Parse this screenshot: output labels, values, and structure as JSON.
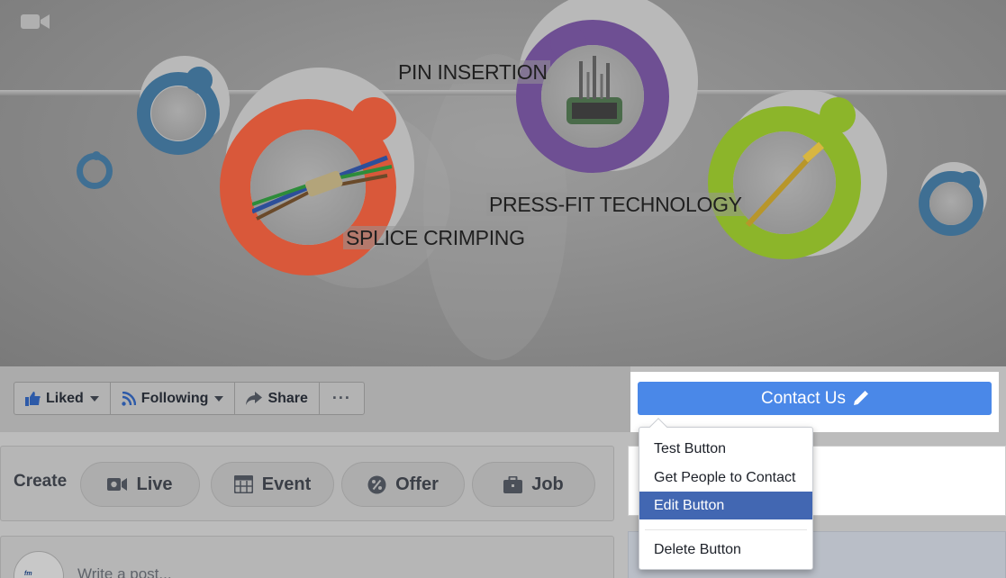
{
  "cover": {
    "labels": {
      "pin_insertion": "PIN INSERTION",
      "press_fit": "PRESS-FIT TECHNOLOGY",
      "splice_crimping": "SPLICE CRIMPING"
    },
    "ring_colors": {
      "blue": "#3f6f93",
      "orange": "#d9583a",
      "purple": "#6e4f93",
      "green": "#8cb52a"
    }
  },
  "page_actions": {
    "liked_label": "Liked",
    "following_label": "Following",
    "share_label": "Share",
    "more_label": "···"
  },
  "cta": {
    "label": "Contact Us",
    "color": "#4a88e8"
  },
  "create": {
    "label": "Create",
    "buttons": [
      {
        "label": "Live",
        "icon": "video-camera-icon"
      },
      {
        "label": "Event",
        "icon": "calendar-icon"
      },
      {
        "label": "Offer",
        "icon": "percent-badge-icon"
      },
      {
        "label": "Job",
        "icon": "briefcase-icon"
      }
    ]
  },
  "composer": {
    "placeholder": "Write a post..."
  },
  "dropdown": {
    "items": [
      {
        "label": "Test Button"
      },
      {
        "label": "Get People to Contact"
      },
      {
        "label": "Edit Button",
        "active": true
      },
      {
        "label": "Delete Button"
      }
    ],
    "active_color": "#4267b2"
  }
}
